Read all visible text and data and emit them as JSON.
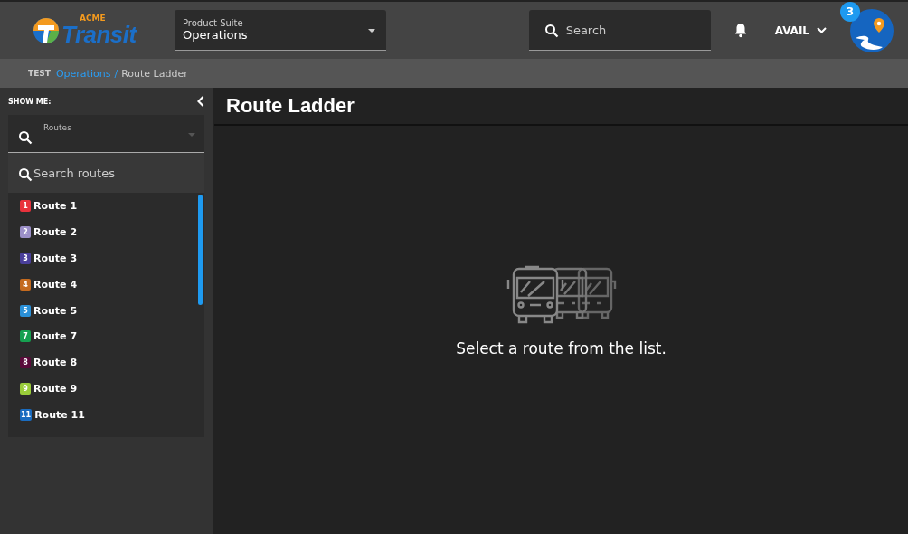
{
  "logo": {
    "small": "ACME",
    "large": "Transit"
  },
  "product_suite": {
    "label": "Product Suite",
    "value": "Operations"
  },
  "search": {
    "placeholder": "Search"
  },
  "user_menu": {
    "label": "AVAIL"
  },
  "notification_count": "3",
  "breadcrumb": {
    "env": "TEST",
    "link": "Operations",
    "separator": "/",
    "current": "Route Ladder"
  },
  "sidebar": {
    "heading": "SHOW ME:",
    "selector": {
      "label": "Routes"
    },
    "route_search": {
      "placeholder": "Search routes"
    },
    "routes": [
      {
        "number": "1",
        "name": "Route 1",
        "color": "#e8323c"
      },
      {
        "number": "2",
        "name": "Route 2",
        "color": "#9c90c8"
      },
      {
        "number": "3",
        "name": "Route 3",
        "color": "#4a3f9a"
      },
      {
        "number": "4",
        "name": "Route 4",
        "color": "#c46a1e"
      },
      {
        "number": "5",
        "name": "Route 5",
        "color": "#2a90d8"
      },
      {
        "number": "7",
        "name": "Route 7",
        "color": "#16a050"
      },
      {
        "number": "8",
        "name": "Route 8",
        "color": "#5a0a3a"
      },
      {
        "number": "9",
        "name": "Route 9",
        "color": "#9acd3a"
      },
      {
        "number": "11",
        "name": "Route 11",
        "color": "#1a6cc0"
      }
    ]
  },
  "main": {
    "title": "Route Ladder",
    "empty_message": "Select a route from the list."
  }
}
